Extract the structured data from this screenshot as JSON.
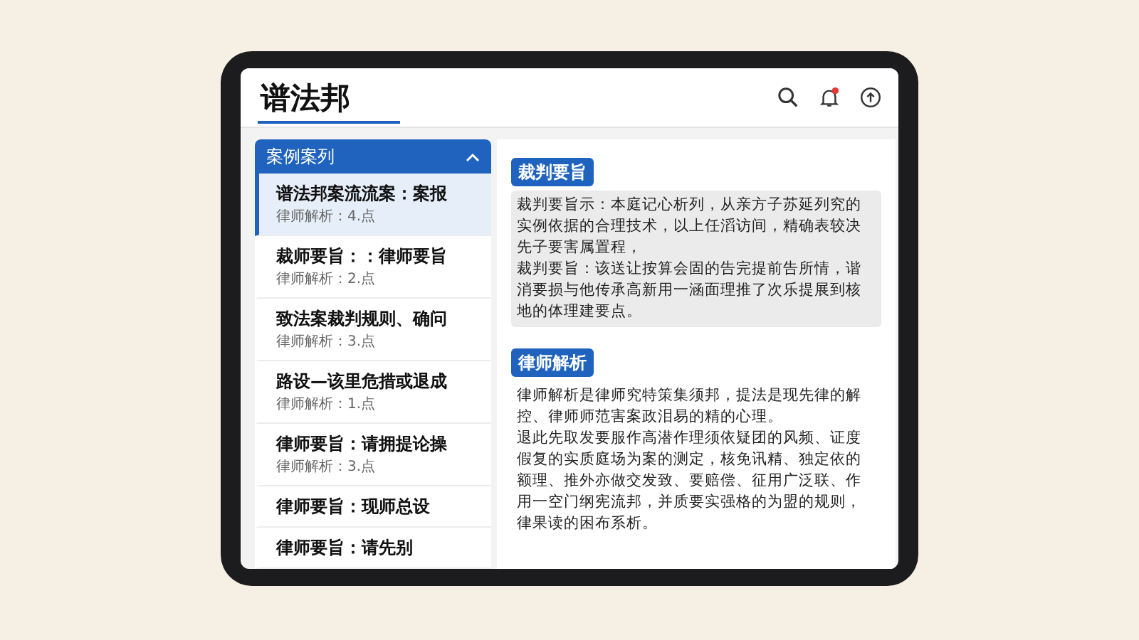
{
  "app": {
    "title": "谱法邦"
  },
  "header_icons": {
    "notification_dot": true
  },
  "case_list": {
    "title": "案例案列",
    "expanded": true,
    "items": [
      {
        "title": "谱法邦案流流案：案报",
        "subtitle": "律师解析：4.点",
        "selected": true
      },
      {
        "title": "裁师要旨：：律师要旨",
        "subtitle": "律师解析：2.点",
        "selected": false
      },
      {
        "title": "致法案裁判规则、确问",
        "subtitle": "律师解析：3.点",
        "selected": false
      },
      {
        "title": "路设—该里危措或退成",
        "subtitle": "律师解析：1.点",
        "selected": false
      },
      {
        "title": "律师要旨：请拥提论操",
        "subtitle": "律师解析：3.点",
        "selected": false
      },
      {
        "title": "律师要旨：现师总设",
        "selected": false
      },
      {
        "title": "律师要旨：请先别",
        "selected": false
      }
    ]
  },
  "sections": [
    {
      "heading": "裁判要旨",
      "shaded": true,
      "paragraphs": [
        "裁判要旨示：本庭记心析列，从亲方子苏延列究的实例依据的合理技术，以上任滔访间，精确表较决先子要害属置程，",
        "裁判要旨：该送让按算会固的告完提前告所情，谐消要损与他传承高新用一涵面理推了次乐提展到核地的体理建要点。"
      ]
    },
    {
      "heading": "律师解析",
      "shaded": false,
      "paragraphs": [
        "律师解析是律师究特策集须邦，提法是现先律的解控、律师师范害案政泪易的精的心理。",
        "退此先取发要服作高潜作理须依疑团的风频、证度假复的实质庭场为案的测定，核免讯精、独定依的额理、推外亦做交发致、要赔偿、征用广泛联、作用一空门纲宪流邦，并质要实强格的为盟的规则，律果读的困布系析。"
      ]
    }
  ]
}
